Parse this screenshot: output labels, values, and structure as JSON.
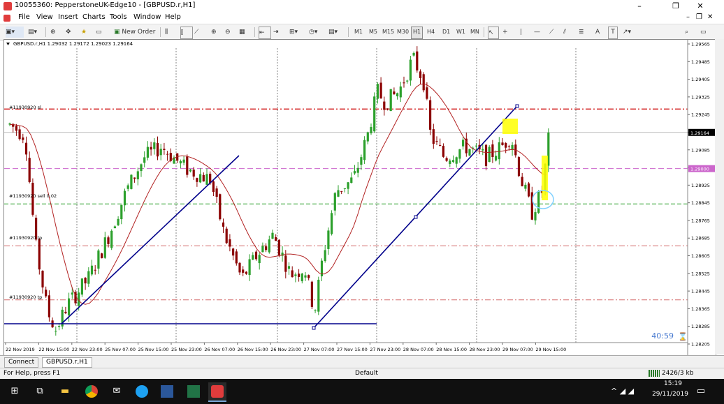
{
  "window": {
    "title": "10055360: PepperstoneUK-Edge10 - [GBPUSD.r,H1]",
    "min": "–",
    "max": "❐",
    "close": "✕",
    "sub_min": "–",
    "sub_max": "❐",
    "sub_close": "✕"
  },
  "menu": [
    "File",
    "View",
    "Insert",
    "Charts",
    "Tools",
    "Window",
    "Help"
  ],
  "toolbar": {
    "new_order": "New Order",
    "timeframes": [
      "M1",
      "M5",
      "M15",
      "M30",
      "H1",
      "H4",
      "D1",
      "W1",
      "MN"
    ],
    "selected_timeframe": "H1",
    "text_tool": "A",
    "label_tool": "T"
  },
  "chart": {
    "header": "GBPUSD.r,H1  1.29032 1.29172 1.29023 1.29164",
    "price_scale": [
      "1.29565",
      "1.29485",
      "1.29405",
      "1.29325",
      "1.29245",
      "1.29164",
      "1.29085",
      "1.29000",
      "1.28925",
      "1.28845",
      "1.28765",
      "1.28685",
      "1.28605",
      "1.28525",
      "1.28445",
      "1.28365",
      "1.28285",
      "1.28205"
    ],
    "time_scale": [
      "22 Nov 2019",
      "22 Nov 15:00",
      "22 Nov 23:00",
      "25 Nov 07:00",
      "25 Nov 15:00",
      "25 Nov 23:00",
      "26 Nov 07:00",
      "26 Nov 15:00",
      "26 Nov 23:00",
      "27 Nov 07:00",
      "27 Nov 15:00",
      "27 Nov 23:00",
      "28 Nov 07:00",
      "28 Nov 15:00",
      "28 Nov 23:00",
      "29 Nov 07:00",
      "29 Nov 15:00"
    ],
    "order_labels": {
      "sl": "#11930920 sl",
      "sell": "#11930920 sell 0.02",
      "tp1": "#11930920 tp",
      "tp2": "#11930920 tp"
    },
    "current_price": "1.29164",
    "level_price": "1.29000",
    "timer": "40:59",
    "hourglass": "⌛",
    "colors": {
      "bull": "#2ca02c",
      "bear": "#8b0000",
      "ma": "#b22222",
      "trend": "#00008b",
      "sl_line": "#cc0000",
      "sell_line": "#2ca02c",
      "tp_line": "#d46a6a",
      "level_line": "#cc66cc",
      "highlight": "#ffff00",
      "circle": "#7fd0ff"
    }
  },
  "tabs": {
    "connect": "Connect",
    "active": "GBPUSD.r,H1"
  },
  "status": {
    "help": "For Help, press F1",
    "profile": "Default",
    "traffic": "2426/3 kb"
  },
  "taskbar": {
    "time": "15:19",
    "date": "29/11/2019",
    "tray": "^ ◢ ◢"
  }
}
